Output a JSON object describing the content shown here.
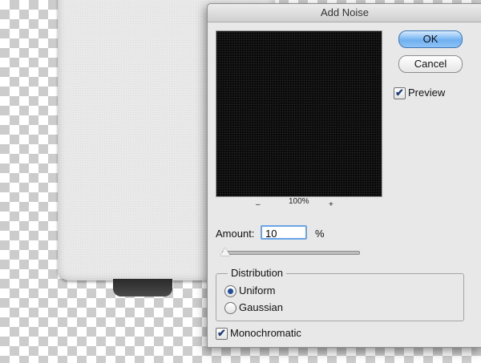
{
  "dialog": {
    "title": "Add Noise",
    "zoom": {
      "minus": "–",
      "level": "100%",
      "plus": "+"
    },
    "ok_label": "OK",
    "cancel_label": "Cancel",
    "preview_label": "Preview",
    "preview_checked": true,
    "amount_label": "Amount:",
    "amount_value": "10",
    "amount_unit": "%",
    "distribution": {
      "title": "Distribution",
      "options": [
        "Uniform",
        "Gaussian"
      ],
      "selected": "Uniform"
    },
    "monochromatic_label": "Monochromatic",
    "monochromatic_checked": true,
    "check_glyph": "✔"
  }
}
